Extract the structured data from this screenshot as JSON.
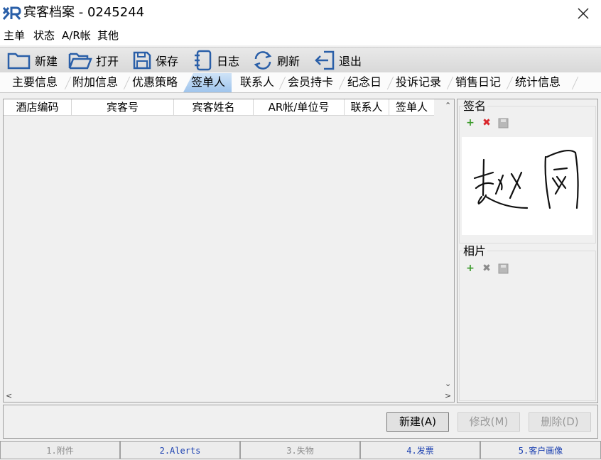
{
  "window": {
    "title": "宾客档案 - 0245244"
  },
  "menu": {
    "items": [
      "主单",
      "状态",
      "A/R帐",
      "其他"
    ]
  },
  "toolbar": {
    "new": "新建",
    "open": "打开",
    "save": "保存",
    "log": "日志",
    "refresh": "刷新",
    "exit": "退出"
  },
  "tabs": {
    "items": [
      "主要信息",
      "附加信息",
      "优惠策略",
      "签单人",
      "联系人",
      "会员持卡",
      "纪念日",
      "投诉记录",
      "销售日记",
      "统计信息"
    ],
    "active": "签单人"
  },
  "grid": {
    "columns": [
      "酒店编码",
      "宾客号",
      "宾客姓名",
      "AR帐/单位号",
      "联系人",
      "签单人"
    ],
    "rows": []
  },
  "signature": {
    "label": "签名"
  },
  "photo": {
    "label": "相片"
  },
  "buttons": {
    "new": "新建(A)",
    "edit": "修改(M)",
    "delete": "删除(D)"
  },
  "bottom_tabs": [
    "1.附件",
    "2.Alerts",
    "3.失物",
    "4.发票",
    "5.客户画像"
  ],
  "colors": {
    "accent_blue": "#2a5fa8",
    "active_tab": "#b6d3f2",
    "add_green": "#3a9a2a",
    "delete_red": "#d9262c"
  }
}
